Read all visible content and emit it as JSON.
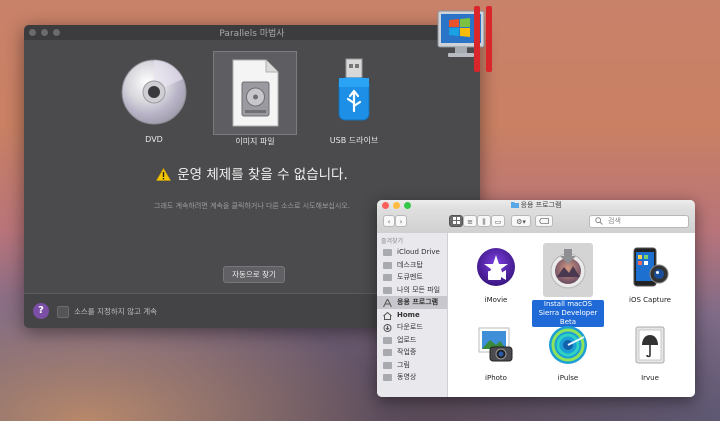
{
  "parallels": {
    "title": "Parallels 마법사",
    "options": [
      {
        "label": "DVD",
        "icon": "dvd-disc-icon"
      },
      {
        "label": "이미지 파일",
        "icon": "image-file-icon"
      },
      {
        "label": "USB 드라이브",
        "icon": "usb-drive-icon"
      }
    ],
    "warning": "운영 체제를 찾을 수 없습니다.",
    "hint": "그래도 계속하려면 계속을 클릭하거나 다른 소스로 시도해보십시오.",
    "auto_find_button": "자동으로 찾기",
    "help_button": "?",
    "skip_source_label": "소스를 지정하지 않고 계속"
  },
  "finder": {
    "title": "응용 프로그램",
    "search_placeholder": "검색",
    "sidebar_heading": "즐겨찾기",
    "sidebar": [
      "iCloud Drive",
      "데스크탑",
      "도큐멘트",
      "나의 모든 파일",
      "응용 프로그램",
      "Home",
      "다운로드",
      "업로드",
      "작업중",
      "그림",
      "동영상"
    ],
    "items": [
      {
        "name": "iMovie",
        "icon": "imovie-icon"
      },
      {
        "name": "Install macOS Sierra Developer Beta",
        "icon": "macos-installer-icon"
      },
      {
        "name": "iOS Capture",
        "icon": "ios-capture-icon"
      },
      {
        "name": "iPhoto",
        "icon": "iphoto-icon"
      },
      {
        "name": "iPulse",
        "icon": "ipulse-icon"
      },
      {
        "name": "Irvue",
        "icon": "irvue-icon"
      }
    ]
  },
  "colors": {
    "accent": "#1f6ad6",
    "warning": "#f5c400",
    "help": "#7b4fa6"
  }
}
